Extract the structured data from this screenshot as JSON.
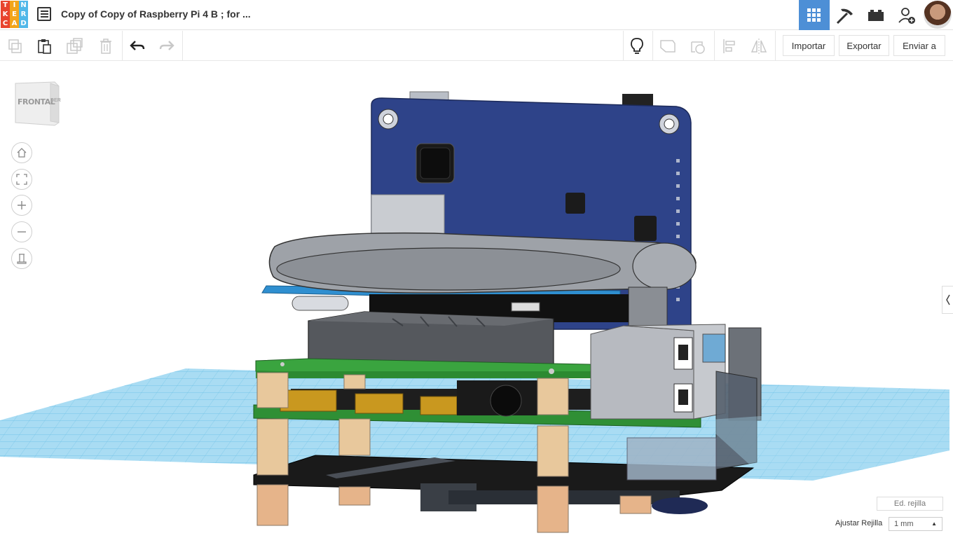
{
  "logo": {
    "letters": [
      "T",
      "I",
      "N",
      "K",
      "E",
      "R",
      "C",
      "A",
      "D"
    ],
    "colors": [
      "#e8432e",
      "#f3a51a",
      "#51b8e9",
      "#e8432e",
      "#f3a51a",
      "#51b8e9",
      "#e8432e",
      "#f3a51a",
      "#51b8e9"
    ]
  },
  "header": {
    "title": "Copy of Copy of Raspberry Pi 4 B ; for ...",
    "icons": [
      "menu-icon",
      "grid-view-icon",
      "pickaxe-icon",
      "bricks-icon",
      "add-user-icon",
      "profile-avatar"
    ]
  },
  "toolbar": {
    "left_icons": [
      "copy-icon",
      "paste-icon",
      "duplicate-icon",
      "trash-icon",
      "undo-icon",
      "redo-icon"
    ],
    "right_icons": [
      "lightbulb-icon",
      "note-icon",
      "workplane-icon",
      "align-icon",
      "mirror-icon"
    ],
    "import_label": "Importar",
    "export_label": "Exportar",
    "send_label": "Enviar a"
  },
  "viewcube": {
    "face_label": "FRONTAL",
    "side_label": "DER"
  },
  "nav_controls": [
    "home-icon",
    "fit-view-icon",
    "zoom-in-icon",
    "zoom-out-icon",
    "perspective-icon"
  ],
  "grid_controls": {
    "edit_grid_label": "Ed. rejilla",
    "snap_label": "Ajustar Rejilla",
    "snap_value": "1 mm"
  },
  "colors": {
    "accent": "#4d8fd6",
    "board_blue": "#2f4282",
    "pcb_green": "#3aa34a",
    "grid": "#8fd0ef"
  }
}
